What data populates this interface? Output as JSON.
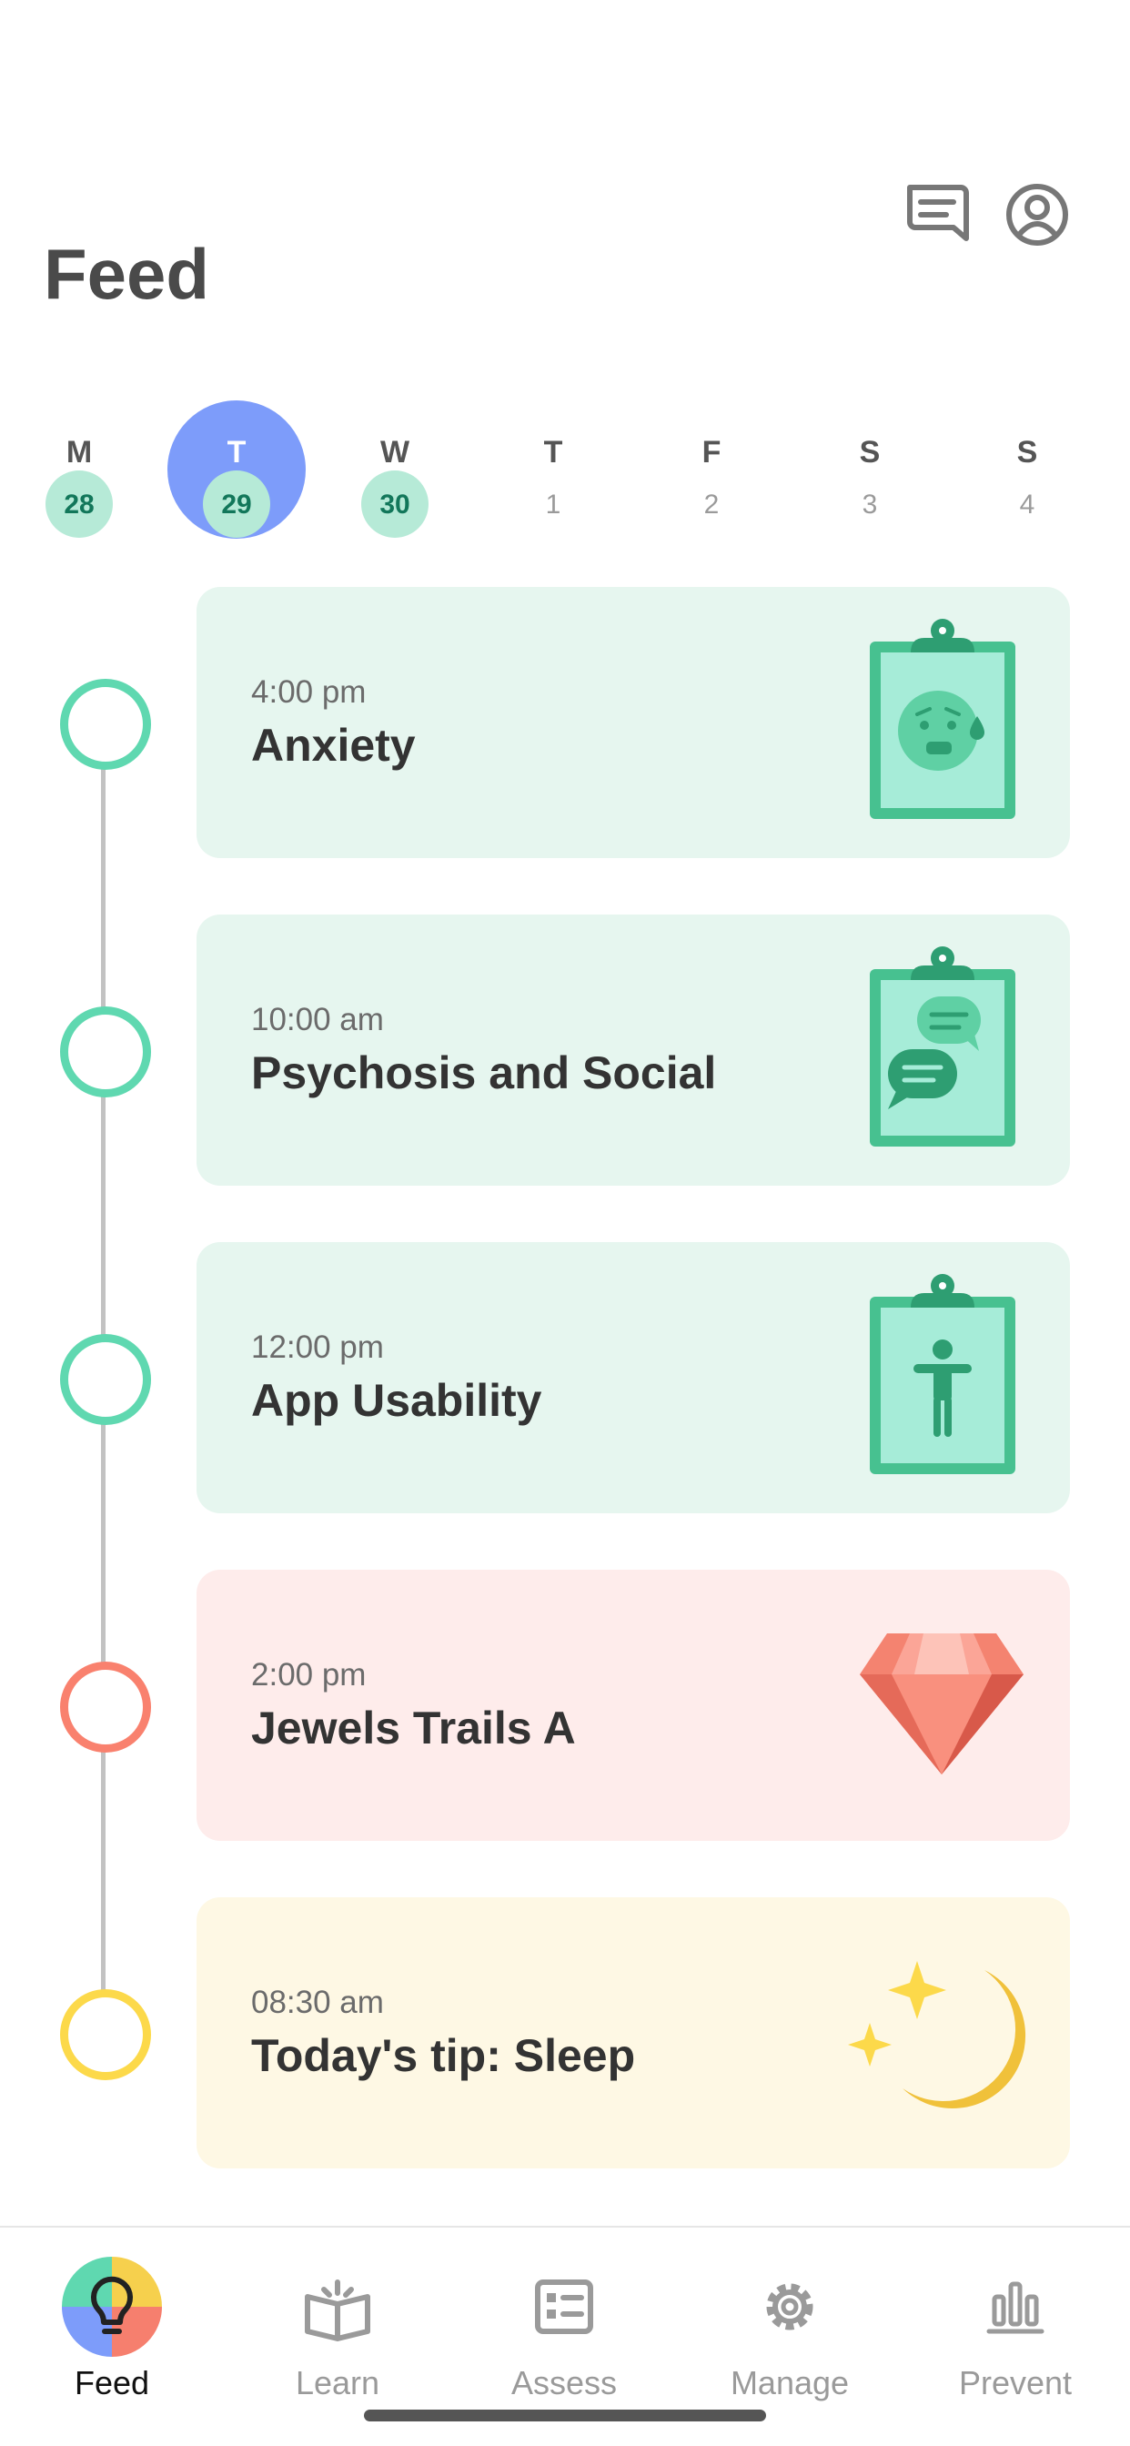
{
  "header": {
    "title": "Feed"
  },
  "icons": {
    "messages": "chat-lines-icon",
    "profile": "user-circle-icon"
  },
  "week": [
    {
      "letter": "M",
      "day": "28",
      "done": true,
      "selected": false
    },
    {
      "letter": "T",
      "day": "29",
      "done": true,
      "selected": true
    },
    {
      "letter": "W",
      "day": "30",
      "done": true,
      "selected": false
    },
    {
      "letter": "T",
      "day": "1",
      "done": false,
      "selected": false
    },
    {
      "letter": "F",
      "day": "2",
      "done": false,
      "selected": false
    },
    {
      "letter": "S",
      "day": "3",
      "done": false,
      "selected": false
    },
    {
      "letter": "S",
      "day": "4",
      "done": false,
      "selected": false
    }
  ],
  "feed": [
    {
      "time": "4:00 pm",
      "title": "Anxiety",
      "icon": "clipboard-anxious-face-icon",
      "color": "#e6f6ef",
      "dot": "#5fd8b0"
    },
    {
      "time": "10:00 am",
      "title": "Psychosis and Social",
      "icon": "clipboard-chat-icon",
      "color": "#e6f6ef",
      "dot": "#5fd8b0"
    },
    {
      "time": "12:00 pm",
      "title": "App Usability",
      "icon": "clipboard-person-icon",
      "color": "#e6f6ef",
      "dot": "#5fd8b0"
    },
    {
      "time": "2:00 pm",
      "title": "Jewels Trails A",
      "icon": "gem-icon",
      "color": "#feeceb",
      "dot": "#f9816e"
    },
    {
      "time": "08:30 am",
      "title": "Today's tip: Sleep",
      "icon": "moon-stars-icon",
      "color": "#fef8e4",
      "dot": "#fcd94a"
    }
  ],
  "nav": [
    {
      "label": "Feed",
      "icon": "lightbulb-icon",
      "active": true
    },
    {
      "label": "Learn",
      "icon": "open-book-icon",
      "active": false
    },
    {
      "label": "Assess",
      "icon": "list-card-icon",
      "active": false
    },
    {
      "label": "Manage",
      "icon": "gear-icon",
      "active": false
    },
    {
      "label": "Prevent",
      "icon": "bar-chart-icon",
      "active": false
    }
  ],
  "colors": {
    "selected": "#7d9cfa",
    "completed_day": "#b6ead7",
    "survey": "#47c190"
  }
}
